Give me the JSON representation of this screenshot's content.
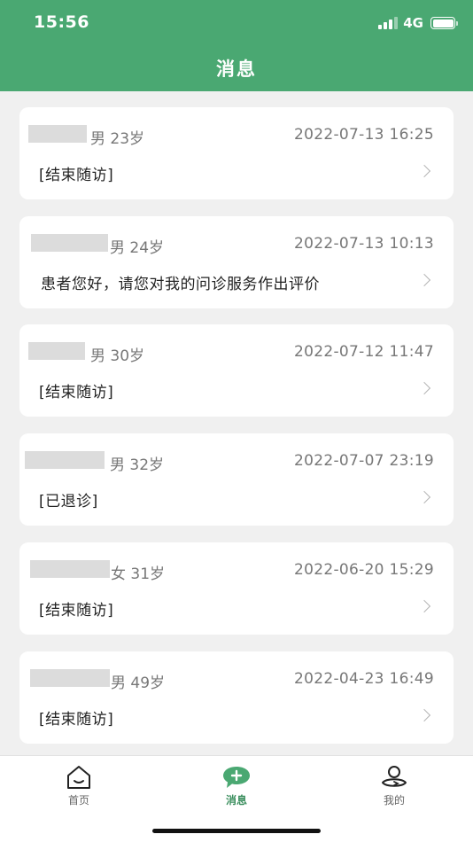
{
  "status_bar": {
    "time": "15:56",
    "network": "4G"
  },
  "header": {
    "title": "消息"
  },
  "messages": [
    {
      "patient_info": "男 23岁",
      "time": "2022-07-13 16:25",
      "text": "[结束随访]"
    },
    {
      "patient_info": "男 24岁",
      "time": "2022-07-13 10:13",
      "text": "患者您好，请您对我的问诊服务作出评价"
    },
    {
      "patient_info": "男 30岁",
      "time": "2022-07-12 11:47",
      "text": "[结束随访]"
    },
    {
      "patient_info": "男 32岁",
      "time": "2022-07-07 23:19",
      "text": "[已退诊]"
    },
    {
      "patient_info": "女 31岁",
      "time": "2022-06-20 15:29",
      "text": "[结束随访]"
    },
    {
      "patient_info": "男 49岁",
      "time": "2022-04-23 16:49",
      "text": "[结束随访]"
    }
  ],
  "tabs": [
    {
      "label": "首页",
      "icon": "home-icon"
    },
    {
      "label": "消息",
      "icon": "message-icon",
      "active": true
    },
    {
      "label": "我的",
      "icon": "profile-icon"
    }
  ],
  "colors": {
    "brand": "#4aa872",
    "active_tab": "#3c8f5f"
  }
}
